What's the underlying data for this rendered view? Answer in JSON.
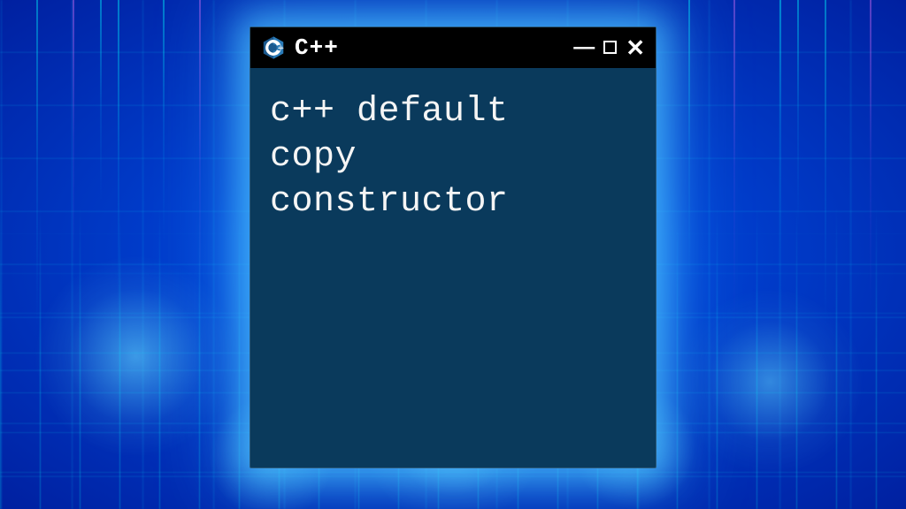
{
  "window": {
    "title": "C++",
    "content": "c++ default\ncopy\nconstructor",
    "logo_name": "cpp-logo"
  },
  "colors": {
    "window_bg": "#0a3a5c",
    "titlebar_bg": "#000000",
    "text": "#f5f5f5",
    "glow": "#50c8ff"
  }
}
